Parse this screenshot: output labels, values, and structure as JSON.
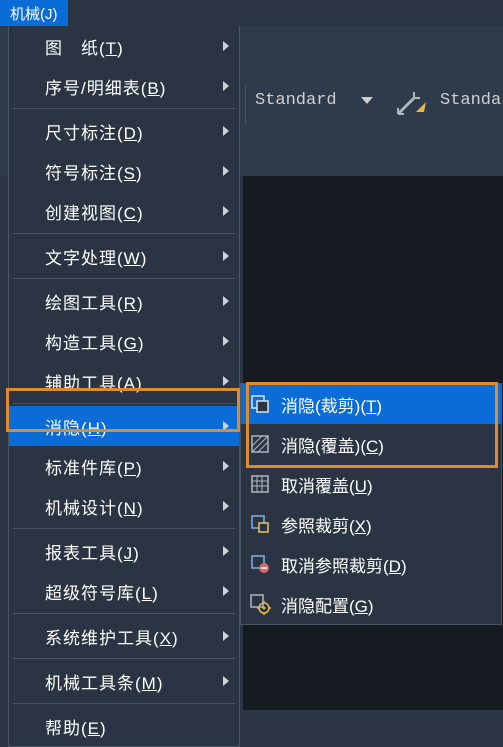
{
  "menubar": {
    "mechanical": "机械(J)"
  },
  "toolbar": {
    "standard1": "Standard",
    "standard2": "Standa"
  },
  "menu": {
    "drawing": "图　纸(T)",
    "bom": "序号/明细表(B)",
    "dimension": "尺寸标注(D)",
    "symbol": "符号标注(S)",
    "create_view": "创建视图(C)",
    "text": "文字处理(W)",
    "draw_tools": "绘图工具(R)",
    "construct_tools": "构造工具(G)",
    "aux_tools": "辅助工具(A)",
    "hide": "消隐(H)",
    "std_parts": "标准件库(P)",
    "mech_design": "机械设计(N)",
    "report_tools": "报表工具(J)",
    "super_symbol": "超级符号库(L)",
    "sys_maint": "系统维护工具(X)",
    "toolbars": "机械工具条(M)",
    "help": "帮助(E)"
  },
  "submenu": {
    "hide_clip": "消隐(裁剪)(T)",
    "hide_cover": "消隐(覆盖)(C)",
    "cancel_cover": "取消覆盖(U)",
    "ref_clip": "参照裁剪(X)",
    "cancel_ref_clip": "取消参照裁剪(D)",
    "hide_config": "消隐配置(G)"
  }
}
